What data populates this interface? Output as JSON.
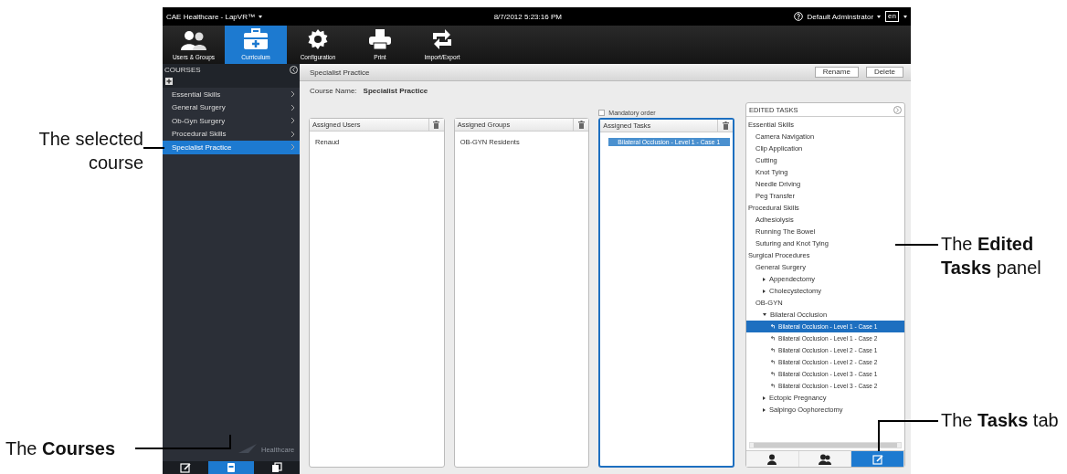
{
  "app_bar": {
    "title": "CAE Healthcare - LapVR™",
    "datetime": "8/7/2012 5:23:16 PM",
    "user": "Default Adminstrator",
    "language": "en"
  },
  "toolbar": [
    {
      "label": "Users & Groups",
      "kind": "users",
      "selected": false
    },
    {
      "label": "Curriculum",
      "kind": "curriculum",
      "selected": true
    },
    {
      "label": "Configuration",
      "kind": "gear",
      "selected": false
    },
    {
      "label": "Print",
      "kind": "print",
      "selected": false
    },
    {
      "label": "Import/Export",
      "kind": "import",
      "selected": false
    }
  ],
  "courses_panel": {
    "title": "COURSES",
    "items": [
      {
        "label": "Essential Skills",
        "selected": false
      },
      {
        "label": "General Surgery",
        "selected": false
      },
      {
        "label": "Ob-Gyn Surgery",
        "selected": false
      },
      {
        "label": "Procedural Skills",
        "selected": false
      },
      {
        "label": "Specialist Practice",
        "selected": true
      }
    ],
    "logo_text": "Healthcare",
    "tabs": [
      {
        "kind": "edit",
        "selected": false
      },
      {
        "kind": "course",
        "selected": true
      },
      {
        "kind": "copy",
        "selected": false
      }
    ]
  },
  "course": {
    "title": "Specialist Practice",
    "buttons": [
      "Rename",
      "Delete"
    ],
    "name_label": "Course Name:",
    "name_value": "Specialist Practice",
    "mandatory_order": {
      "label": "Mandatory order",
      "checked": false
    },
    "lists": [
      {
        "title": "Assigned Users",
        "items": [
          {
            "label": "Renaud",
            "selected": false
          }
        ]
      },
      {
        "title": "Assigned Groups",
        "items": [
          {
            "label": "OB-GYN Residents",
            "selected": false
          }
        ]
      },
      {
        "title": "Assigned Tasks",
        "items": [
          {
            "label": "Bilateral Occlusion - Level 1 - Case 1",
            "selected": true
          }
        ]
      }
    ]
  },
  "edited_tasks": {
    "title": "EDITED TASKS",
    "tree": [
      {
        "label": "Essential Skills",
        "selected": false,
        "children": [
          {
            "label": "Camera Navigation",
            "selected": false
          },
          {
            "label": "Clip Application",
            "selected": false
          },
          {
            "label": "Cutting",
            "selected": false
          },
          {
            "label": "Knot Tying",
            "selected": false
          },
          {
            "label": "Needle Driving",
            "selected": false
          },
          {
            "label": "Peg Transfer",
            "selected": false
          }
        ]
      },
      {
        "label": "Procedural Skills",
        "selected": false,
        "children": [
          {
            "label": "Adhesiolysis",
            "selected": false
          },
          {
            "label": "Running The Bowel",
            "selected": false
          },
          {
            "label": "Suturing and Knot Tying",
            "selected": false
          }
        ]
      },
      {
        "label": "Surgical Procedures",
        "selected": false,
        "children": [
          {
            "label": "General Surgery",
            "selected": false,
            "children": [
              {
                "label": "Appendectomy",
                "selected": false,
                "expanded": false
              },
              {
                "label": "Cholecystectomy",
                "selected": false,
                "expanded": false
              }
            ]
          },
          {
            "label": "OB-GYN",
            "selected": false,
            "children": [
              {
                "label": "Bilateral Occlusion",
                "selected": false,
                "expanded": true,
                "children": [
                  {
                    "label": "Bilateral Occlusion - Level 1 - Case 1",
                    "selected": true
                  },
                  {
                    "label": "Bilateral Occlusion - Level 1 - Case 2",
                    "selected": false
                  },
                  {
                    "label": "Bilateral Occlusion - Level 2 - Case 1",
                    "selected": false
                  },
                  {
                    "label": "Bilateral Occlusion - Level 2 - Case 2",
                    "selected": false
                  },
                  {
                    "label": "Bilateral Occlusion - Level 3 - Case 1",
                    "selected": false
                  },
                  {
                    "label": "Bilateral Occlusion - Level 3 - Case 2",
                    "selected": false
                  }
                ]
              },
              {
                "label": "Ectopic Pregnancy",
                "selected": false,
                "expanded": false
              },
              {
                "label": "Salpingo Oophorectomy",
                "selected": false,
                "expanded": false
              }
            ]
          }
        ]
      }
    ],
    "tabs": [
      {
        "kind": "user",
        "selected": false
      },
      {
        "kind": "users",
        "selected": false
      },
      {
        "kind": "edit",
        "selected": true
      }
    ]
  },
  "callouts": [
    {
      "text": "The selected course"
    },
    {
      "text": "The **Edited Tasks** panel"
    },
    {
      "text": "The **Courses**"
    },
    {
      "text": "The **Tasks** tab"
    }
  ]
}
